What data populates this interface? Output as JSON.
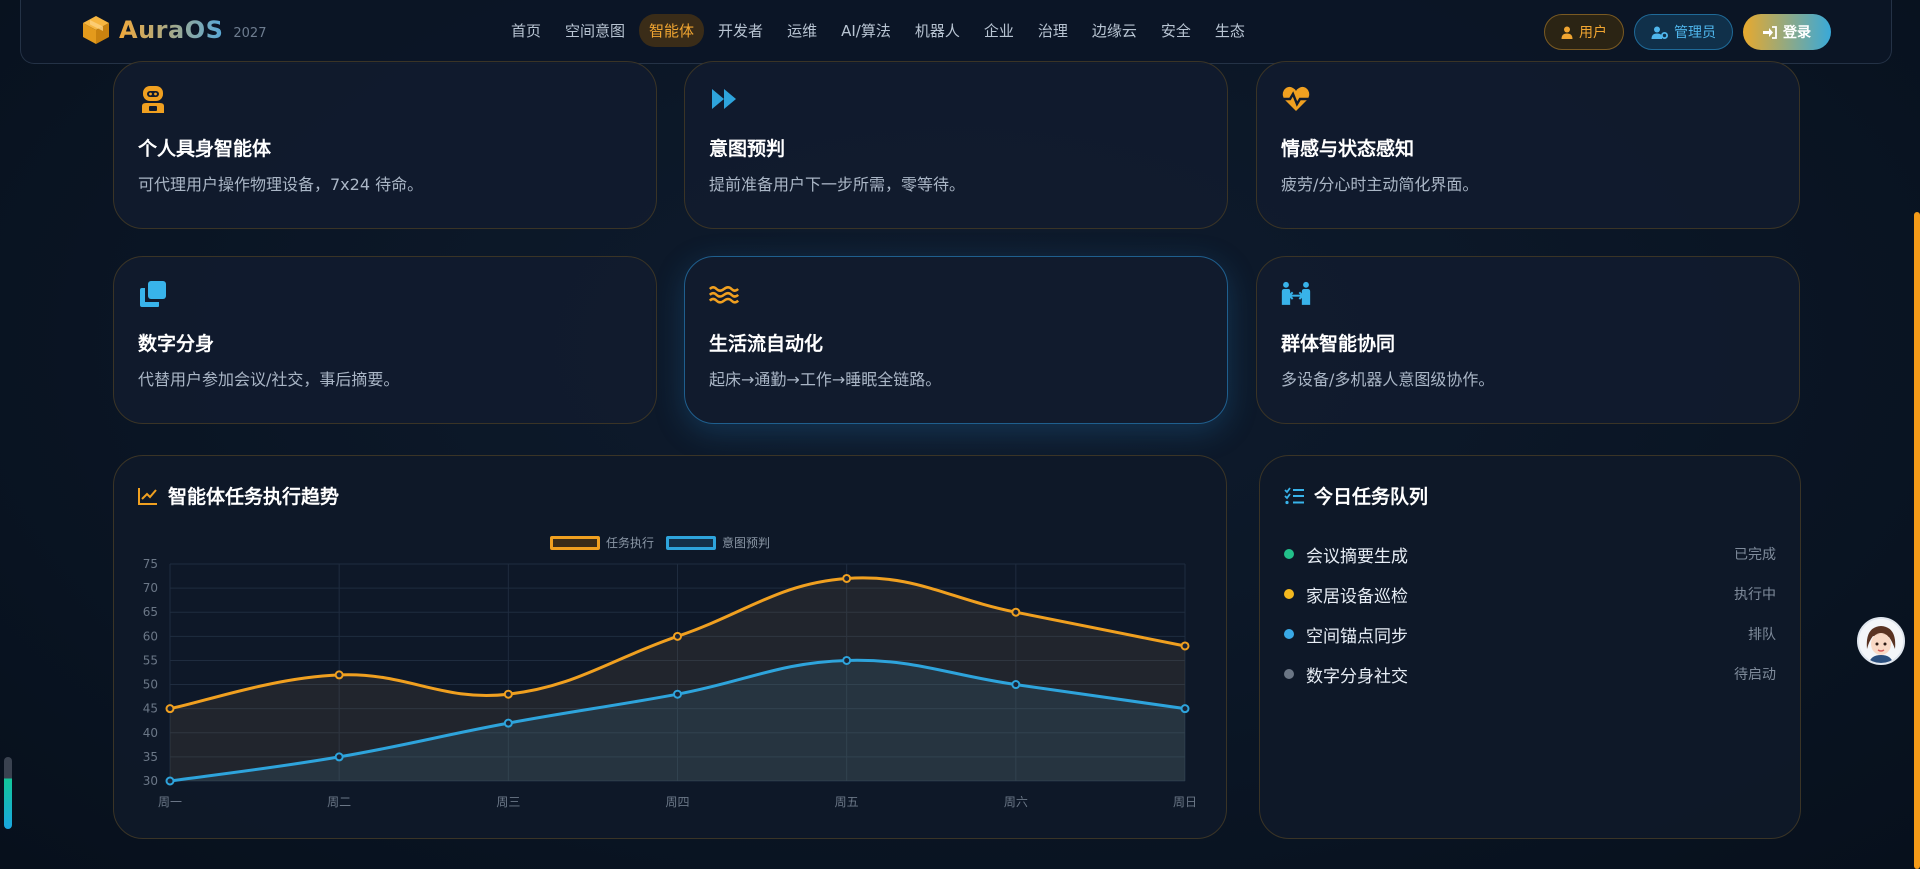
{
  "header": {
    "logo_text": "AuraOS",
    "logo_year": "2027",
    "nav": [
      "首页",
      "空间意图",
      "智能体",
      "开发者",
      "运维",
      "AI/算法",
      "机器人",
      "企业",
      "治理",
      "边缘云",
      "安全",
      "生态"
    ],
    "active_nav": "智能体",
    "user_label": "用户",
    "admin_label": "管理员",
    "login_label": "登录"
  },
  "cards": [
    {
      "title": "个人具身智能体",
      "desc": "可代理用户操作物理设备，7x24 待命。",
      "icon": "robot-icon"
    },
    {
      "title": "意图预判",
      "desc": "提前准备用户下一步所需，零等待。",
      "icon": "fast-forward-icon"
    },
    {
      "title": "情感与状态感知",
      "desc": "疲劳/分心时主动简化界面。",
      "icon": "heart-pulse-icon"
    },
    {
      "title": "数字分身",
      "desc": "代替用户参加会议/社交，事后摘要。",
      "icon": "clone-icon"
    },
    {
      "title": "生活流自动化",
      "desc": "起床→通勤→工作→睡眠全链路。",
      "icon": "water-waves-icon"
    },
    {
      "title": "群体智能协同",
      "desc": "多设备/多机器人意图级协作。",
      "icon": "people-arrows-icon"
    }
  ],
  "chart_panel": {
    "title": "智能体任务执行趋势"
  },
  "chart_data": {
    "type": "line",
    "categories": [
      "周一",
      "周二",
      "周三",
      "周四",
      "周五",
      "周六",
      "周日"
    ],
    "series": [
      {
        "name": "任务执行",
        "values": [
          45,
          52,
          48,
          60,
          72,
          65,
          58
        ],
        "color": "#f0a020"
      },
      {
        "name": "意图预判",
        "values": [
          30,
          35,
          42,
          48,
          55,
          50,
          45
        ],
        "color": "#2ea4dc"
      }
    ],
    "ylim": [
      30,
      75
    ],
    "yticks": [
      30,
      35,
      40,
      45,
      50,
      55,
      60,
      65,
      70,
      75
    ],
    "grid": true,
    "legend": "top-center"
  },
  "queue_panel": {
    "title": "今日任务队列",
    "tasks": [
      {
        "name": "会议摘要生成",
        "status": "已完成",
        "dot": "#22c08a"
      },
      {
        "name": "家居设备巡检",
        "status": "执行中",
        "dot": "#f3b81f"
      },
      {
        "name": "空间锚点同步",
        "status": "排队",
        "dot": "#39a9e6"
      },
      {
        "name": "数字分身社交",
        "status": "待启动",
        "dot": "#6b7685"
      }
    ]
  }
}
